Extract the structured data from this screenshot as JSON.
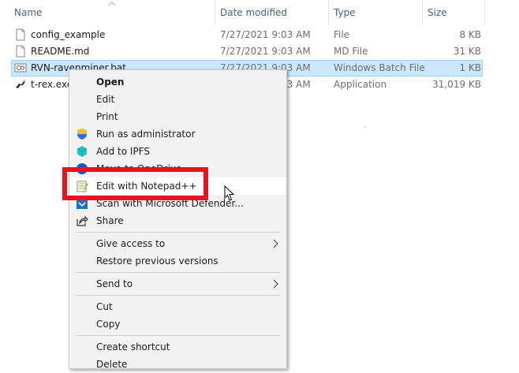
{
  "columns": {
    "name": "Name",
    "date_modified": "Date modified",
    "type": "Type",
    "size": "Size"
  },
  "files": [
    {
      "name": "config_example",
      "date": "7/27/2021 9:03 AM",
      "type": "File",
      "size": "8 KB",
      "icon": "blank-file-icon"
    },
    {
      "name": "README.md",
      "date": "7/27/2021 9:03 AM",
      "type": "MD File",
      "size": "31 KB",
      "icon": "blank-file-icon"
    },
    {
      "name": "RVN-ravenminer.bat",
      "date": "7/27/2021 9:03 AM",
      "type": "Windows Batch File",
      "size": "1 KB",
      "icon": "batch-file-icon",
      "selected": true
    },
    {
      "name": "t-rex.exe",
      "date": "7/27/2021 9:03 AM",
      "type": "Application",
      "size": "31,019 KB",
      "icon": "trex-app-icon"
    }
  ],
  "context_menu": {
    "items": [
      {
        "label": "Open",
        "bold": true
      },
      {
        "label": "Edit"
      },
      {
        "label": "Print"
      },
      {
        "label": "Run as administrator",
        "icon": "uac-shield-icon"
      },
      {
        "label": "Add to IPFS",
        "icon": "ipfs-cube-icon"
      },
      {
        "label": "Move to OneDrive",
        "icon": "onedrive-icon"
      },
      {
        "label": "Edit with Notepad++",
        "icon": "notepad-plus-plus-icon"
      },
      {
        "label": "Scan with Microsoft Defender...",
        "icon": "defender-icon"
      },
      {
        "label": "Share",
        "icon": "share-icon"
      },
      {
        "label": "Give access to",
        "submenu": true
      },
      {
        "label": "Restore previous versions"
      },
      {
        "label": "Send to",
        "submenu": true
      },
      {
        "label": "Cut"
      },
      {
        "label": "Copy"
      },
      {
        "label": "Create shortcut"
      },
      {
        "label": "Delete"
      }
    ]
  },
  "colors": {
    "selection_bg": "#cce8ff",
    "selection_border": "#99d1ff",
    "annotation_red": "#e8141c",
    "menu_bg": "#f2f2f2",
    "header_text": "#4c607a"
  }
}
